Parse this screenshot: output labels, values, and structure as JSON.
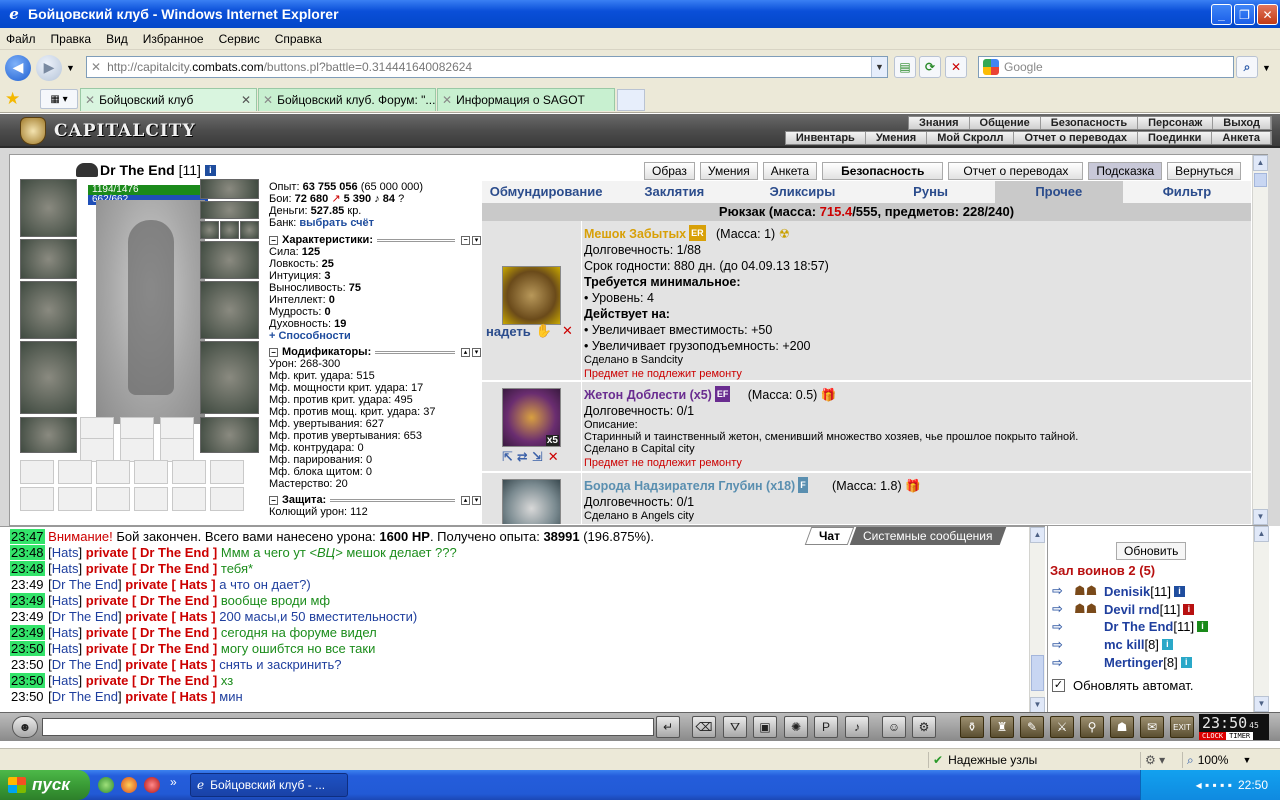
{
  "window": {
    "title": "Бойцовский клуб - Windows Internet Explorer",
    "min": "_",
    "max": "❐",
    "close": "✕"
  },
  "menu": [
    "Файл",
    "Правка",
    "Вид",
    "Избранное",
    "Сервис",
    "Справка"
  ],
  "address": {
    "prefix": "http://capitalcity.",
    "domain": "combats.com",
    "rest": "/buttons.pl?battle=0.314441640082624"
  },
  "search": {
    "placeholder": "Google"
  },
  "tabs": [
    {
      "label": "Бойцовский клуб",
      "active": true
    },
    {
      "label": "Бойцовский клуб. Форум: \"...",
      "active": false
    },
    {
      "label": "Информация о SAGOT",
      "active": false
    }
  ],
  "game": {
    "logo": "CAPITALCITY",
    "toplinks1": [
      "Знания",
      "Общение",
      "Безопасность",
      "Персонаж",
      "Выход"
    ],
    "toplinks2": [
      "Инвентарь",
      "Умения",
      "Мой Скролл",
      "Отчет о переводах",
      "Поединки",
      "Анкета"
    ]
  },
  "character": {
    "name": "Dr The End",
    "level": "[11]",
    "hp": "1194/1476",
    "mp": "662/662",
    "exp_label": "Опыт:",
    "exp": "63 755 056",
    "exp_next": "(65 000 000)",
    "fights_label": "Бои:",
    "wins": "72 680",
    "losses": "5 390",
    "draws": "84",
    "money_label": "Деньги:",
    "money": "527.85",
    "money_unit": "кр.",
    "bank_label": "Банк:",
    "bank_link": "выбрать счёт",
    "sect_chars": "Характеристики:",
    "stats": [
      {
        "k": "Сила:",
        "v": "125"
      },
      {
        "k": "Ловкость:",
        "v": "25"
      },
      {
        "k": "Интуиция:",
        "v": "3"
      },
      {
        "k": "Выносливость:",
        "v": "75"
      },
      {
        "k": "Интеллект:",
        "v": "0"
      },
      {
        "k": "Мудрость:",
        "v": "0"
      },
      {
        "k": "Духовность:",
        "v": "19"
      }
    ],
    "abilities": "+ Способности",
    "sect_mods": "Модификаторы:",
    "mods": [
      "Урон: 268-300",
      "Мф. крит. удара: 515",
      "Мф. мощности крит. удара: 17",
      "Мф. против крит. удара: 495",
      "Мф. против мощ. крит. удара: 37",
      "Мф. увертывания: 627",
      "Мф. против увертывания: 653",
      "Мф. контрудара: 0",
      "Мф. парирования: 0",
      "Мф. блока щитом: 0",
      "Мастерство: 20"
    ],
    "sect_def": "Защита:",
    "def": "Колющий урон: 112"
  },
  "buttons": [
    {
      "label": "Образ",
      "style": ""
    },
    {
      "label": "Умения",
      "style": ""
    },
    {
      "label": "Анкета",
      "style": ""
    },
    {
      "label": "Безопасность",
      "style": "bold"
    },
    {
      "label": "Отчет о переводах",
      "style": ""
    },
    {
      "label": "Подсказка",
      "style": "hl"
    },
    {
      "label": "Вернуться",
      "style": ""
    }
  ],
  "invtabs": [
    "Обмундирование",
    "Заклятия",
    "Эликсиры",
    "Руны",
    "Прочее",
    "Фильтр"
  ],
  "bag": {
    "pre": "Рюкзак (масса: ",
    "mass": "715.4",
    "post": "/555, предметов: 228/240)"
  },
  "items": [
    {
      "name": "Мешок Забытых",
      "badge": "ER",
      "mass": "(Масса: 1)",
      "action": "надеть",
      "lines": [
        "Долговечность: 1/88",
        "Срок годности: 880 дн. (до 04.09.13 18:57)"
      ],
      "req_title": "Требуется минимальное:",
      "req": "• Уровень: 4",
      "eff_title": "Действует на:",
      "eff": [
        "• Увеличивает вместимость: +50",
        "• Увеличивает грузоподъемность: +200"
      ],
      "made": "Сделано в Sandcity",
      "repair": "Предмет не подлежит ремонту"
    },
    {
      "name": "Жетон Доблести (x5)",
      "badge": "EF",
      "mass": "(Масса: 0.5)",
      "count": "x5",
      "dur": "Долговечность: 0/1",
      "desc_title": "Описание:",
      "desc": "Старинный и таинственный жетон, сменивший множество хозяев, чье прошлое покрыто тайной.",
      "made": "Сделано в Capital city",
      "repair": "Предмет не подлежит ремонту"
    },
    {
      "name": "Борода Надзирателя Глубин (x18)",
      "badge": "F",
      "mass": "(Масса: 1.8)",
      "dur": "Долговечность: 0/1",
      "made": "Сделано в Angels city"
    }
  ],
  "chat": {
    "tabs": [
      "Чат",
      "Системные сообщения"
    ],
    "lines": [
      {
        "ts": "23:47",
        "hl": true,
        "type": "sys",
        "warn": "Внимание!",
        "text": " Бой закончен. Всего вами нанесено урона: ",
        "b1": "1600 HP",
        "t2": ". Получено опыта: ",
        "b2": "38991",
        "t3": " (196.875%)."
      },
      {
        "ts": "23:48",
        "hl": true,
        "from": "Hats",
        "to": "Dr The End",
        "msg": "Ммм а чего ут ",
        "tag": "<ВЦ>",
        "msg2": " мешок делает ???",
        "c": "msg1"
      },
      {
        "ts": "23:48",
        "hl": true,
        "from": "Hats",
        "to": "Dr The End",
        "msg": "тебя*",
        "c": "msg1"
      },
      {
        "ts": "23:49",
        "hl": false,
        "from": "Dr The End",
        "to": "Hats",
        "msg": "а что он дает?)",
        "c": "msg2"
      },
      {
        "ts": "23:49",
        "hl": true,
        "from": "Hats",
        "to": "Dr The End",
        "msg": "вообще вроди мф",
        "c": "msg1"
      },
      {
        "ts": "23:49",
        "hl": false,
        "from": "Dr The End",
        "to": "Hats",
        "msg": "200 масы,и 50 вместительности)",
        "c": "msg2"
      },
      {
        "ts": "23:49",
        "hl": true,
        "from": "Hats",
        "to": "Dr The End",
        "msg": "сегодня на форуме видел",
        "c": "msg1"
      },
      {
        "ts": "23:50",
        "hl": true,
        "from": "Hats",
        "to": "Dr The End",
        "msg": "могу ошибтся но все таки",
        "c": "msg1"
      },
      {
        "ts": "23:50",
        "hl": false,
        "from": "Dr The End",
        "to": "Hats",
        "msg": "снять и заскринить?",
        "c": "msg2"
      },
      {
        "ts": "23:50",
        "hl": true,
        "from": "Hats",
        "to": "Dr The End",
        "msg": "хз",
        "c": "msg1"
      },
      {
        "ts": "23:50",
        "hl": false,
        "from": "Dr The End",
        "to": "Hats",
        "msg": "мин",
        "c": "msg2"
      }
    ],
    "private": "private"
  },
  "room": {
    "refresh": "Обновить",
    "title": "Зал воинов 2 (5)",
    "players": [
      {
        "name": "Denisik",
        "lvl": "[11]",
        "color": "#1f4d9e"
      },
      {
        "name": "Devil rnd",
        "lvl": "[11]",
        "color": "#b81010"
      },
      {
        "name": "Dr The End",
        "lvl": "[11]",
        "color": "#1a8a1a"
      },
      {
        "name": "mc kill",
        "lvl": "[8]",
        "color": "#2aa8c8"
      },
      {
        "name": "Mertinger",
        "lvl": "[8]",
        "color": "#2aa8c8"
      }
    ],
    "auto": "Обновлять автомат."
  },
  "clock": {
    "time": "23:50",
    "sec": "45",
    "clock_label": "CLOCK",
    "timer_label": "TIMER"
  },
  "status": {
    "secure": "Надежные узлы",
    "zoom": "100%"
  },
  "taskbar": {
    "start": "пуск",
    "task": "Бойцовский клуб - ...",
    "time": "22:50"
  }
}
